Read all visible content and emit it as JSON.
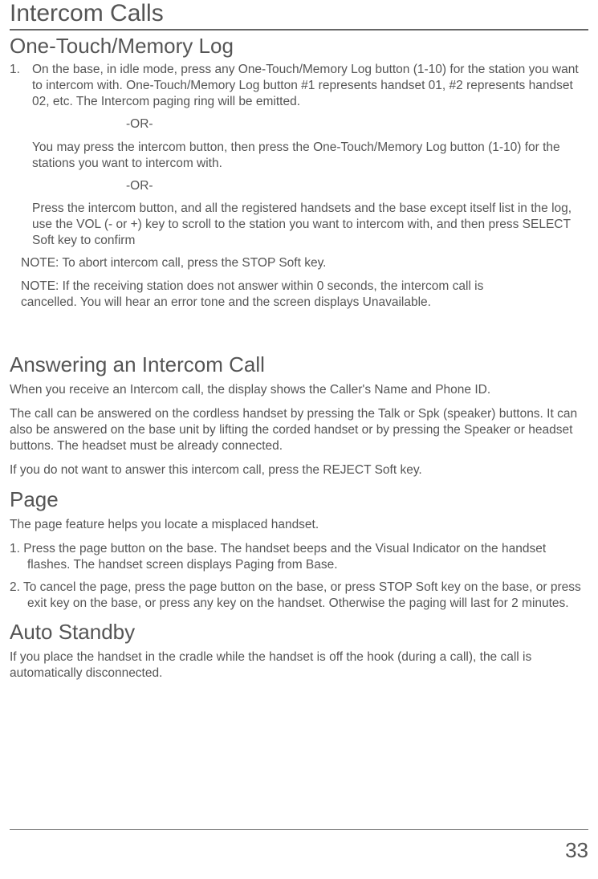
{
  "title": "Intercom Calls",
  "section1": {
    "heading": "One-Touch/Memory Log",
    "item1_number": "1.",
    "item1_text": "On the base, in idle mode, press any One-Touch/Memory Log button (1-10) for the station you want to intercom with. One-Touch/Memory Log  button #1 represents handset 01, #2 represents handset 02, etc.  The Intercom paging ring will be emitted.",
    "or1": "-OR-",
    "alt1": "You may press the intercom button, then press the One-Touch/Memory Log button (1-10) for the stations you want to intercom with.",
    "or2": "-OR-",
    "alt2": "Press the intercom  button, and all the registered handsets and the base except itself list in the log, use the VOL (- or +) key to scroll to the station you want to intercom with, and then press SELECT Soft key to confirm",
    "note1": "NOTE: To abort intercom call, press the STOP Soft key.",
    "note2": "NOTE: If the receiving station does not answer within 0 seconds, the intercom call is cancelled. You will hear an error tone and the screen displays Unavailable."
  },
  "section2": {
    "heading": "Answering an Intercom Call",
    "p1": "When you receive an Intercom call, the display shows the Caller's Name and Phone ID.",
    "p2": "The call can be answered on the cordless handset by pressing the Talk or Spk (speaker) buttons.  It can also be answered on the base unit by lifting the corded handset or by pressing the Speaker or headset buttons.  The headset must be already connected.",
    "p3": "If you do not want to answer this intercom call, press the REJECT  Soft key."
  },
  "section3": {
    "heading": "Page",
    "p1": "The page feature helps you locate a misplaced handset.",
    "item1": "1. Press the page button on the base. The handset beeps and the Visual Indicator on the handset flashes. The handset screen displays Paging from Base.",
    "item2": "2. To cancel the page, press the page button on the base, or press STOP Soft key on the base, or press exit key on the base, or press any key on the handset. Otherwise the paging will last for 2 minutes."
  },
  "section4": {
    "heading": "Auto Standby",
    "p1": "If you place the handset in the cradle while the handset is off the hook (during a call), the call is automatically disconnected."
  },
  "page_number": "33"
}
